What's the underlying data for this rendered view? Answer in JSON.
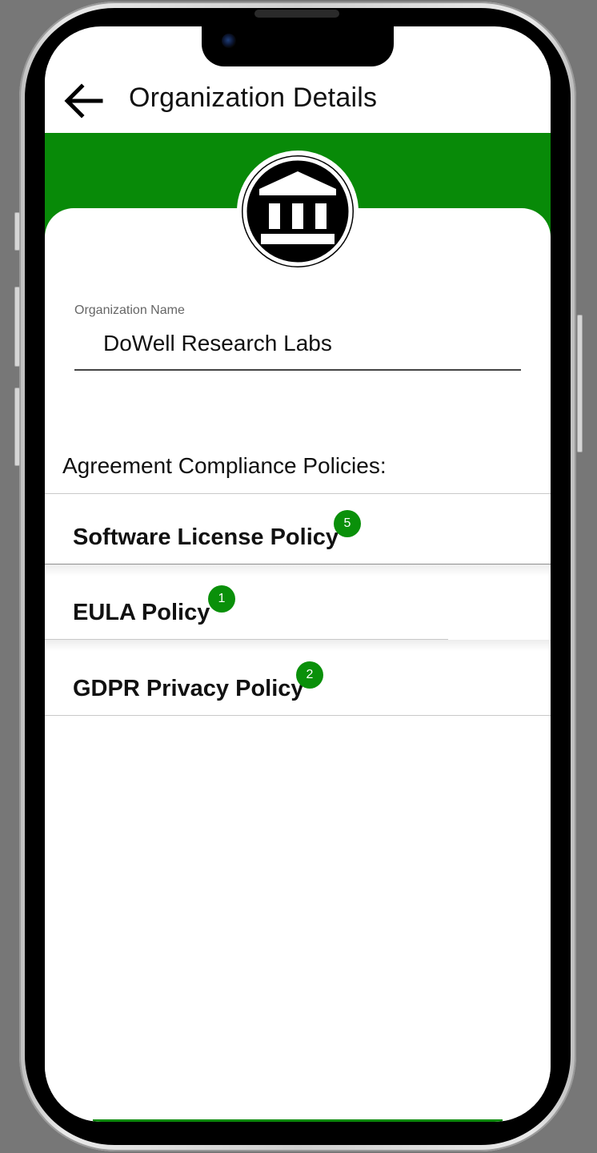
{
  "app_bar": {
    "title": "Organization Details",
    "back_icon": "arrow-left-icon"
  },
  "header": {
    "accent_color": "#088a08",
    "avatar_icon": "bank-building-icon"
  },
  "organization": {
    "field_label": "Organization Name",
    "field_value": "DoWell Research Labs"
  },
  "policies": {
    "section_title": "Agreement Compliance Policies:",
    "items": [
      {
        "label": "Software License Policy",
        "count": "5"
      },
      {
        "label": "EULA Policy",
        "count": "1"
      },
      {
        "label": "GDPR Privacy Policy",
        "count": "2"
      }
    ],
    "badge_color": "#0a900a"
  }
}
